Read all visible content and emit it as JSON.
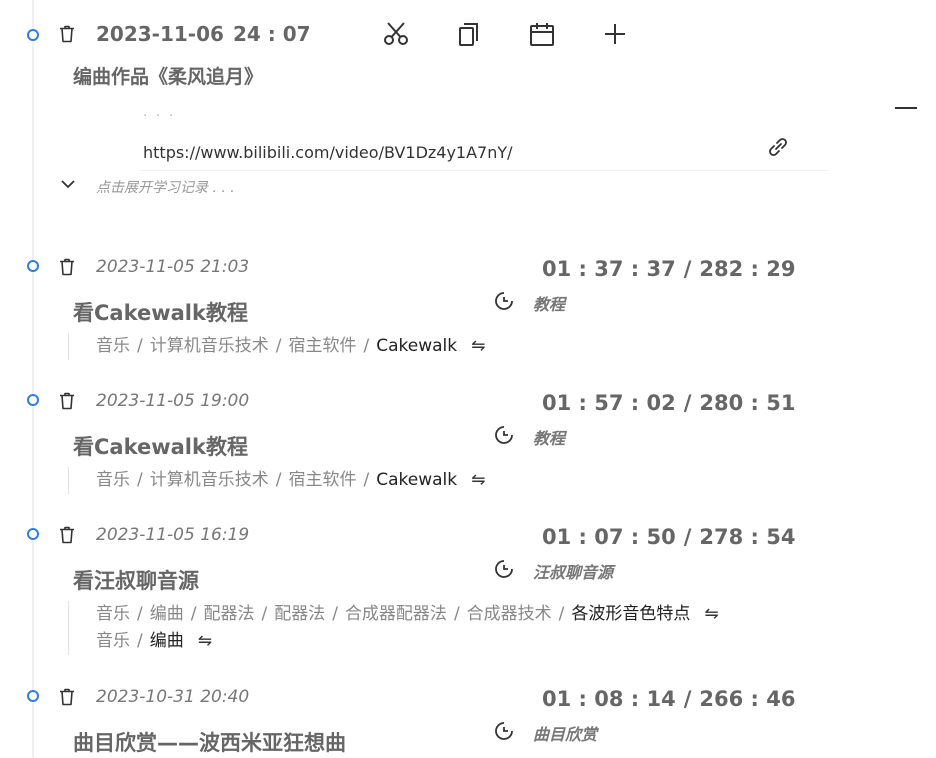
{
  "first_entry": {
    "date": "2023-11-06",
    "time": "24 : 07",
    "title": "编曲作品《柔风追月》",
    "ellipsis": "· · ·",
    "url": "https://www.bilibili.com/video/BV1Dz4y1A7nY/",
    "expand_hint": "点击展开学习记录 . . ."
  },
  "entries": [
    {
      "datetime": "2023-11-05 21:03",
      "timer_elapsed": "01 : 37 : 37",
      "timer_total": "282 : 29",
      "title": "看Cakewalk教程",
      "category": "教程",
      "tag_rows": [
        [
          "音乐",
          "计算机音乐技术",
          "宿主软件",
          "Cakewalk"
        ]
      ]
    },
    {
      "datetime": "2023-11-05 19:00",
      "timer_elapsed": "01 : 57 : 02",
      "timer_total": "280 : 51",
      "title": "看Cakewalk教程",
      "category": "教程",
      "tag_rows": [
        [
          "音乐",
          "计算机音乐技术",
          "宿主软件",
          "Cakewalk"
        ]
      ]
    },
    {
      "datetime": "2023-11-05 16:19",
      "timer_elapsed": "01 : 07 : 50",
      "timer_total": "278 : 54",
      "title": "看汪叔聊音源",
      "category": "汪叔聊音源",
      "tag_rows": [
        [
          "音乐",
          "编曲",
          "配器法",
          "配器法",
          "合成器配器法",
          "合成器技术",
          "各波形音色特点"
        ],
        [
          "音乐",
          "编曲"
        ]
      ]
    },
    {
      "datetime": "2023-10-31 20:40",
      "timer_elapsed": "01 : 08 : 14",
      "timer_total": "266 : 46",
      "title": "曲目欣赏——波西米亚狂想曲",
      "category": "曲目欣赏",
      "tag_rows": []
    }
  ],
  "symbols": {
    "slash": "/",
    "timer_sep": "/",
    "swap": "⇋"
  },
  "icons": [
    "trash-icon",
    "scissors-icon",
    "copy-icon",
    "calendar-icon",
    "plus-icon",
    "minus-icon",
    "link-icon",
    "chevron-down-icon",
    "clock-icon",
    "swap-icon"
  ],
  "colors": {
    "accent": "#2f7de1",
    "text_muted": "#888888",
    "text_main": "#666666"
  }
}
